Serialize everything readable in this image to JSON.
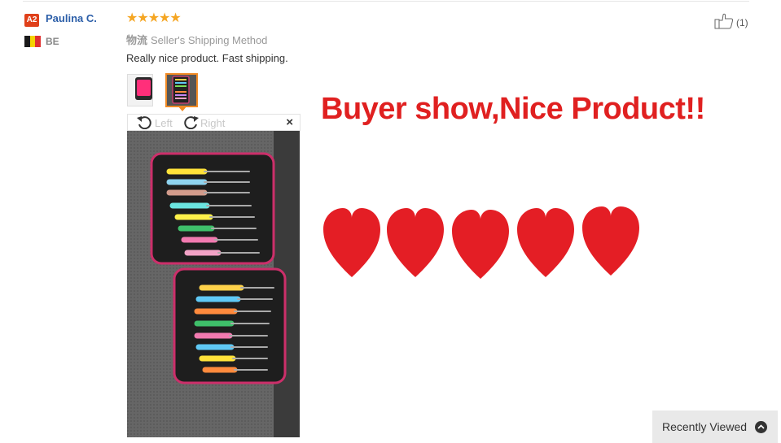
{
  "review": {
    "level_badge": "A2",
    "user_name": "Paulina C.",
    "country": "BE",
    "rating_stars": "★★★★★",
    "rating_value": 5,
    "shipping_label": "物流",
    "shipping_method": "Seller's Shipping Method",
    "text": "Really nice product. Fast shipping.",
    "helpful_count": "(1)"
  },
  "viewer": {
    "rotate_left_label": "Left",
    "rotate_right_label": "Right",
    "close_symbol": "×"
  },
  "promo": {
    "headline": "Buyer show,Nice Product!!",
    "heart_color": "#e41e25"
  },
  "footer": {
    "recently_viewed_label": "Recently Viewed"
  },
  "colors": {
    "accent": "#f08a24",
    "link": "#2b5ea8",
    "badge": "#e0401a",
    "star": "#f5a623",
    "headline": "#e02020"
  },
  "icons": {
    "helpful": "thumbs-up-icon",
    "rotate_left": "rotate-left-icon",
    "rotate_right": "rotate-right-icon",
    "close": "close-icon",
    "recently_viewed_toggle": "chevron-up-icon"
  }
}
